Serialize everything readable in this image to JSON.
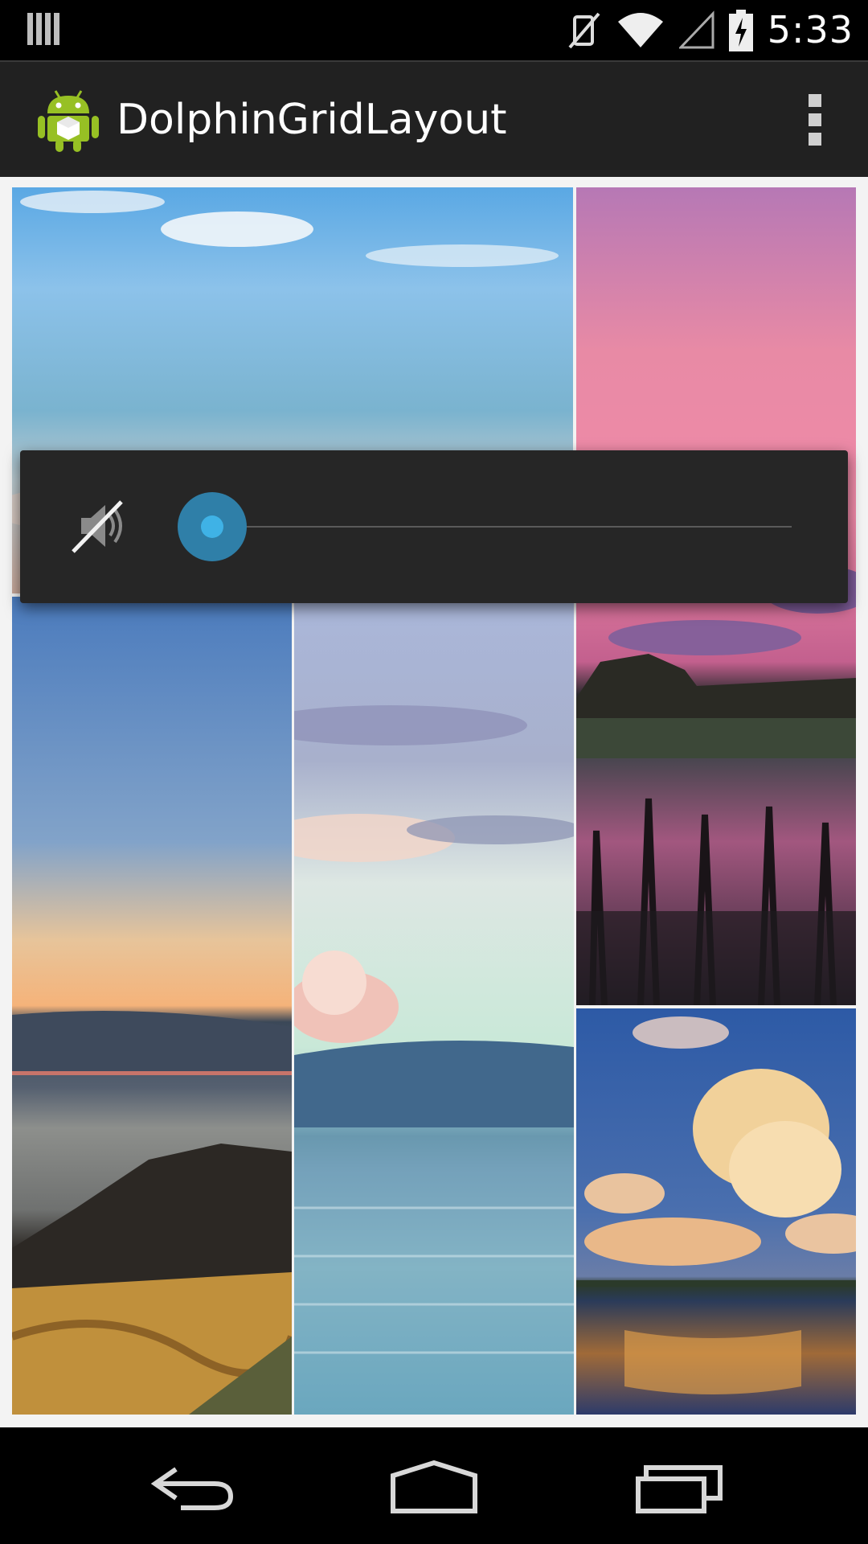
{
  "status_bar": {
    "time": "5:33",
    "icons": [
      "notification-bars-icon",
      "vibrate-icon",
      "wifi-icon",
      "signal-icon",
      "battery-charging-icon"
    ]
  },
  "action_bar": {
    "title": "DolphinGridLayout",
    "app_icon": "android-robot-icon",
    "overflow_icon": "overflow-menu-icon"
  },
  "gallery": {
    "tiles": [
      {
        "id": "photo-foggy-coast"
      },
      {
        "id": "photo-pink-sunset-marsh"
      },
      {
        "id": "photo-blue-sky-rocky-shore"
      },
      {
        "id": "photo-pastel-sea-clouds"
      },
      {
        "id": "photo-golden-cloud-lake"
      }
    ]
  },
  "volume_dialog": {
    "icon": "volume-muted-icon",
    "level": 0
  },
  "nav_bar": {
    "buttons": [
      "back-icon",
      "home-icon",
      "recent-apps-icon"
    ]
  },
  "colors": {
    "accent": "#33b5e5",
    "panel": "#262626",
    "action_bar": "#212121"
  }
}
